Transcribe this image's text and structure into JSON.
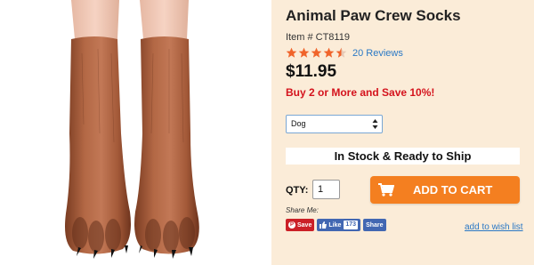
{
  "product": {
    "title": "Animal Paw Crew Socks",
    "item_number": "Item # CT8119",
    "rating_stars": 4.5,
    "reviews_label": "20 Reviews",
    "price": "$11.95",
    "promo": "Buy 2 or More and Save 10%!"
  },
  "options": {
    "selected": "Dog"
  },
  "stock": {
    "status": "In Stock & Ready to Ship"
  },
  "purchase": {
    "qty_label": "QTY:",
    "qty_value": "1",
    "add_to_cart_label": "ADD TO CART"
  },
  "share": {
    "label": "Share Me:",
    "pinterest_label": "Save",
    "facebook_like_label": "Like",
    "facebook_like_count": "173",
    "facebook_share_label": "Share",
    "wishlist_label": "add to wish list"
  },
  "colors": {
    "panel_bg": "#fbecd8",
    "accent_orange": "#f47f20",
    "promo_red": "#d4131d",
    "link_blue": "#2a78c5",
    "star_color": "#f0642b"
  }
}
